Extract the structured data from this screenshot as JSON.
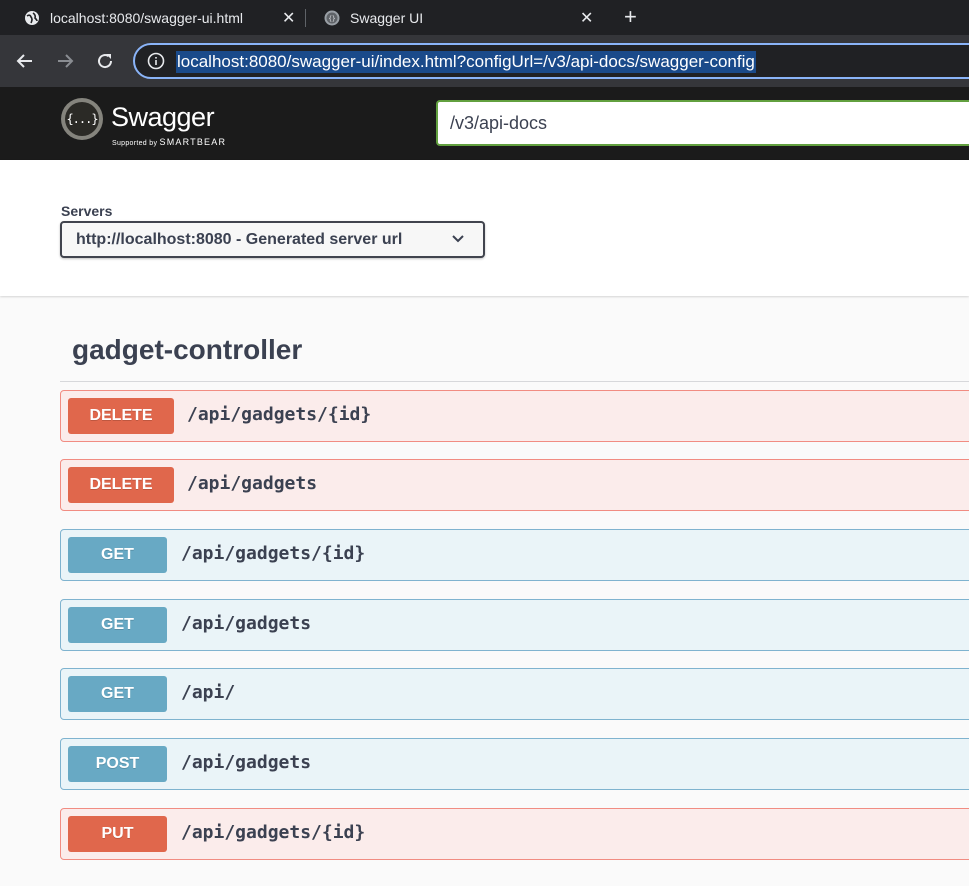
{
  "browser": {
    "tabs": [
      {
        "title": "localhost:8080/swagger-ui.html",
        "icon": "globe-icon"
      },
      {
        "title": "Swagger UI",
        "icon": "swagger-favicon"
      }
    ],
    "address": "localhost:8080/swagger-ui/index.html?configUrl=/v3/api-docs/swagger-config"
  },
  "topbar": {
    "logo_mark": "{...}",
    "logo_text": "Swagger",
    "logo_sub_prefix": "Supported by",
    "logo_sub_brand": "SMARTBEAR",
    "spec_url": "/v3/api-docs"
  },
  "servers": {
    "label": "Servers",
    "selected": "http://localhost:8080 - Generated server url"
  },
  "tag": {
    "title": "gadget-controller"
  },
  "operations": [
    {
      "method": "DELETE",
      "path": "/api/gadgets/{id}"
    },
    {
      "method": "DELETE",
      "path": "/api/gadgets"
    },
    {
      "method": "GET",
      "path": "/api/gadgets/{id}"
    },
    {
      "method": "GET",
      "path": "/api/gadgets"
    },
    {
      "method": "GET",
      "path": "/api/"
    },
    {
      "method": "POST",
      "path": "/api/gadgets"
    },
    {
      "method": "PUT",
      "path": "/api/gadgets/{id}"
    }
  ],
  "colors": {
    "delete": "#e0674c",
    "get": "#68a9c4",
    "topbar": "#1b1b1b",
    "accent_green": "#62a03f"
  }
}
